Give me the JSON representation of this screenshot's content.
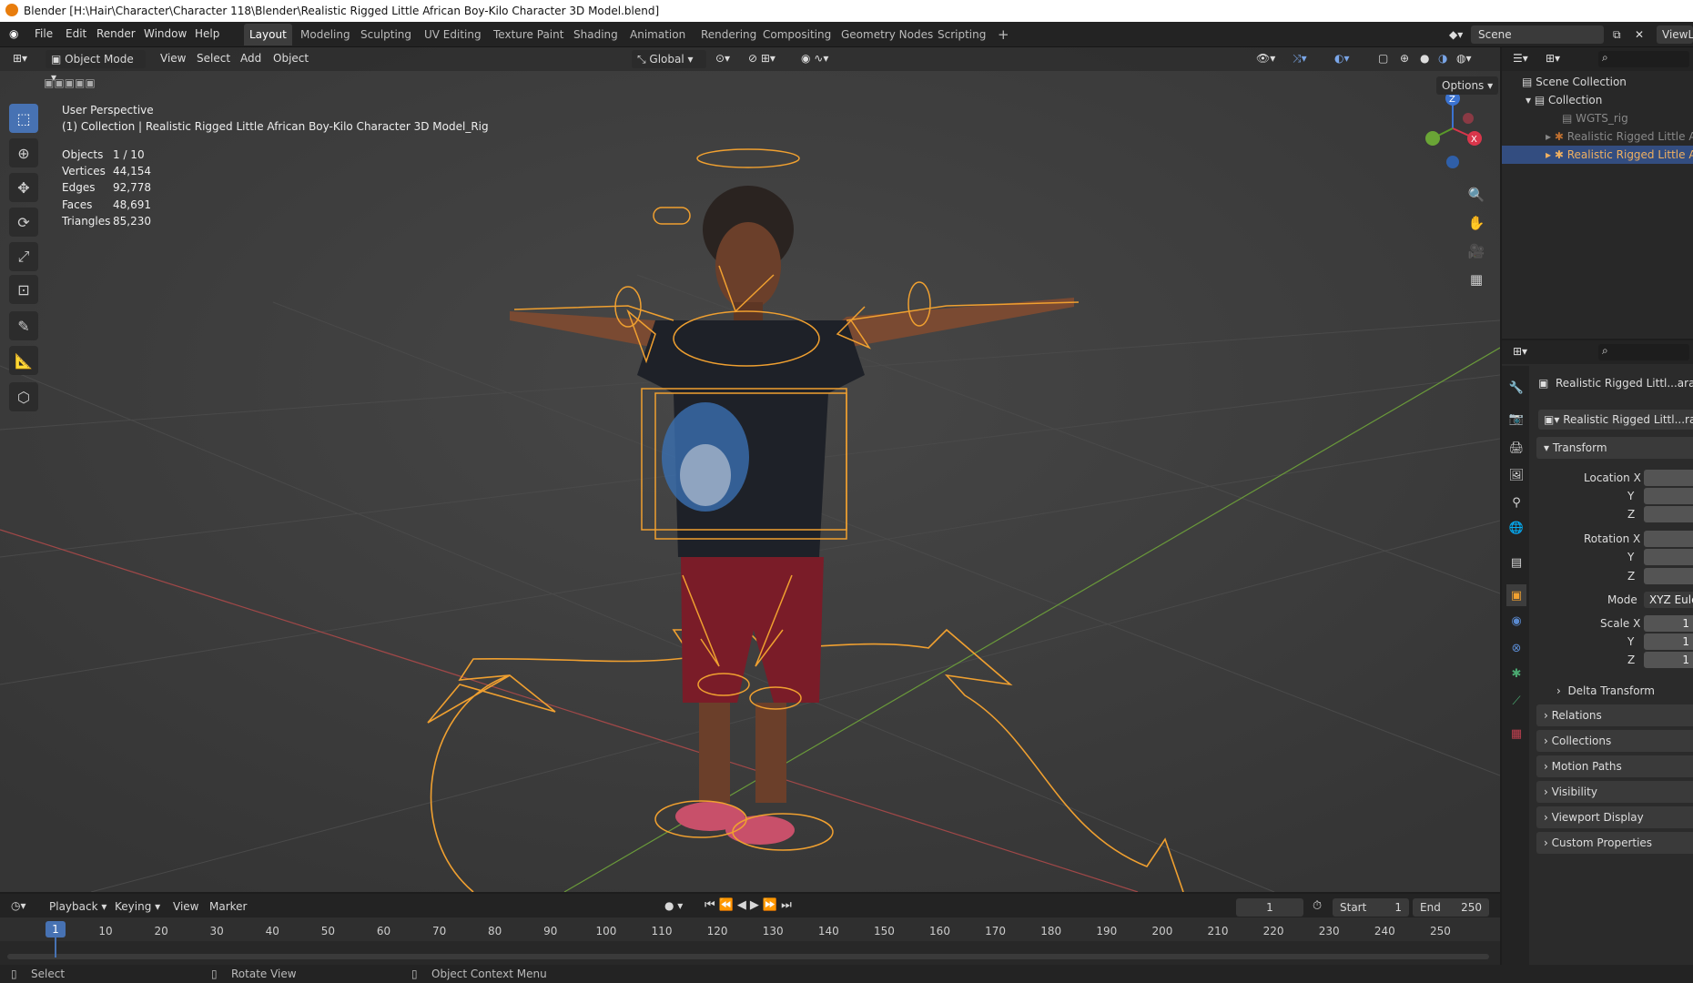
{
  "window": {
    "title": "Blender [H:\\Hair\\Character\\Character 118\\Blender\\Realistic Rigged Little African Boy-Kilo Character 3D Model.blend]"
  },
  "menu": [
    "File",
    "Edit",
    "Render",
    "Window",
    "Help"
  ],
  "workspaces": [
    "Layout",
    "Modeling",
    "Sculpting",
    "UV Editing",
    "Texture Paint",
    "Shading",
    "Animation",
    "Rendering",
    "Compositing",
    "Geometry Nodes",
    "Scripting"
  ],
  "active_workspace": "Layout",
  "scene": {
    "name": "Scene",
    "view_layer": "ViewL"
  },
  "viewport_header": {
    "mode": "Object Mode",
    "menus": [
      "View",
      "Select",
      "Add",
      "Object"
    ],
    "orientation": "Global",
    "options": "Options"
  },
  "overlay": {
    "perspective": "User Perspective",
    "collection": "(1) Collection | Realistic Rigged Little African Boy-Kilo Character 3D Model_Rig",
    "stats": [
      {
        "label": "Objects",
        "value": "1 / 10"
      },
      {
        "label": "Vertices",
        "value": "44,154"
      },
      {
        "label": "Edges",
        "value": "92,778"
      },
      {
        "label": "Faces",
        "value": "48,691"
      },
      {
        "label": "Triangles",
        "value": "85,230"
      }
    ]
  },
  "gizmo": {
    "z": "Z",
    "x": "X"
  },
  "outliner": {
    "scene_collection": "Scene Collection",
    "collection": "Collection",
    "items": [
      "WGTS_rig",
      "Realistic Rigged Little A",
      "Realistic Rigged Little A"
    ]
  },
  "properties": {
    "object_name": "Realistic Rigged Littl...aract",
    "data_name": "Realistic Rigged Littl...rac",
    "transform": "Transform",
    "location": [
      "Location X",
      "Y",
      "Z"
    ],
    "rotation": [
      "Rotation X",
      "Y",
      "Z"
    ],
    "mode_label": "Mode",
    "mode_value": "XYZ Eule",
    "scale": [
      "Scale X",
      "Y",
      "Z"
    ],
    "scale_values": [
      "1",
      "1",
      "1"
    ],
    "sections": [
      "Delta Transform",
      "Relations",
      "Collections",
      "Motion Paths",
      "Visibility",
      "Viewport Display",
      "Custom Properties"
    ]
  },
  "timeline": {
    "menus": [
      "Playback",
      "Keying",
      "View",
      "Marker"
    ],
    "current_frame": "1",
    "start_label": "Start",
    "start": "1",
    "end_label": "End",
    "end": "250",
    "ticks": [
      "10",
      "20",
      "30",
      "40",
      "50",
      "60",
      "70",
      "80",
      "90",
      "100",
      "110",
      "120",
      "130",
      "140",
      "150",
      "160",
      "170",
      "180",
      "190",
      "200",
      "210",
      "220",
      "230",
      "240",
      "250"
    ],
    "playhead": "1"
  },
  "statusbar": {
    "select": "Select",
    "rotate": "Rotate View",
    "context": "Object Context Menu"
  },
  "colors": {
    "accent": "#4772b3",
    "rig": "#f0a030",
    "selected_row": "#334d80"
  }
}
